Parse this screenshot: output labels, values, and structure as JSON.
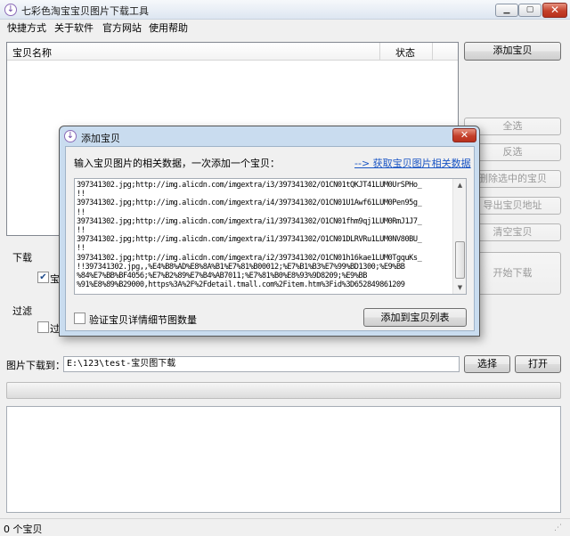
{
  "window": {
    "title": "七彩色淘宝宝贝图片下载工具",
    "controls": {
      "minimize": "▁",
      "maximize": "▢",
      "close": "✕"
    }
  },
  "menu": [
    "快捷方式",
    "关于软件",
    "官方网站",
    "使用帮助"
  ],
  "list": {
    "columns": {
      "name": "宝贝名称",
      "status": "状态"
    },
    "rows": []
  },
  "buttons": {
    "add_item": "添加宝贝",
    "select_all": "全选",
    "invert": "反选",
    "delete_selected": "删除选中的宝贝",
    "export": "导出宝贝地址",
    "clear": "清空宝贝",
    "start_download": "开始下载",
    "choose": "选择",
    "open": "打开"
  },
  "download_section": {
    "label": "下载",
    "option_label": "宝"
  },
  "filter_section": {
    "label": "过滤",
    "option_label": "过"
  },
  "download_path": {
    "label": "图片下载到：",
    "value": "E:\\123\\test-宝贝图下载"
  },
  "progress": 0,
  "status": "0 个宝贝",
  "dialog": {
    "title": "添加宝贝",
    "prompt": "输入宝贝图片的相关数据，一次添加一个宝贝：",
    "help_link": "--> 获取宝贝图片相关数据",
    "text_lines": [
      "397341302.jpg;http://img.alicdn.com/imgextra/i3/397341302/O1CN01tQKJT41LUM0UrSPHo_",
      "!!",
      "397341302.jpg;http://img.alicdn.com/imgextra/i4/397341302/O1CN01U1Awf61LUM0Pen95g_",
      "!!",
      "397341302.jpg;http://img.alicdn.com/imgextra/i1/397341302/O1CN01fhm9qj1LUM0RmJ1J7_",
      "!!",
      "397341302.jpg;http://img.alicdn.com/imgextra/i1/397341302/O1CN01DLRVRu1LUM0NV80BU_",
      "!!",
      "397341302.jpg;http://img.alicdn.com/imgextra/i2/397341302/O1CN01h16kae1LUM0TgquKs_",
      "!!397341302.jpg,,%E4%B8%AD%E8%8A%B1%E7%81%B00012;%E7%B1%B3%E7%99%BD1300;%E9%BB",
      "%84%E7%BB%BF4056;%E7%B2%89%E7%B4%AB7011;%E7%81%B0%E8%93%9D8209;%E9%BB",
      "%91%E8%89%B29000,https%3A%2F%2Fdetail.tmall.com%2Fitem.htm%3Fid%3D652849861209"
    ],
    "verify_label": "验证宝贝详情细节图数量",
    "verify_checked": false,
    "add_to_list": "添加到宝贝列表"
  }
}
